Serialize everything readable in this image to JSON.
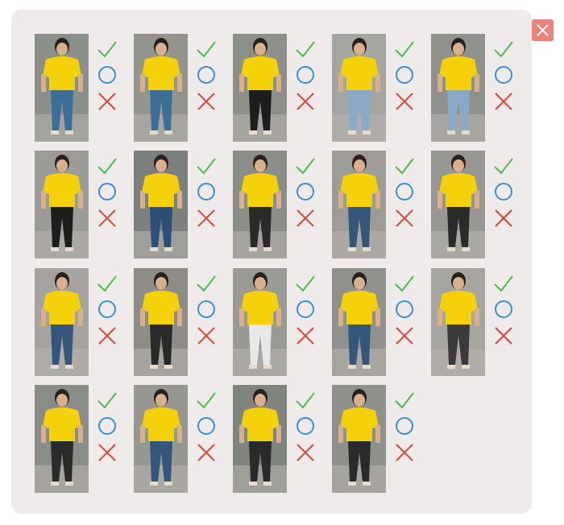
{
  "dialog": {
    "close_icon": "close-icon",
    "colors": {
      "panel_bg": "#efebea",
      "close_bg": "#e8837c",
      "check": "#4dbb4d",
      "circle": "#3a8fd6",
      "cross": "#e0443a"
    }
  },
  "grid": {
    "rows": 4,
    "columns": 5,
    "row_counts": [
      5,
      5,
      5,
      4
    ],
    "total_images": 19,
    "options": [
      {
        "name": "accept",
        "icon": "checkmark-icon"
      },
      {
        "name": "unsure",
        "icon": "circle-icon"
      },
      {
        "name": "reject",
        "icon": "cross-icon"
      }
    ],
    "subject_shirt_color": "#f5d10c"
  }
}
